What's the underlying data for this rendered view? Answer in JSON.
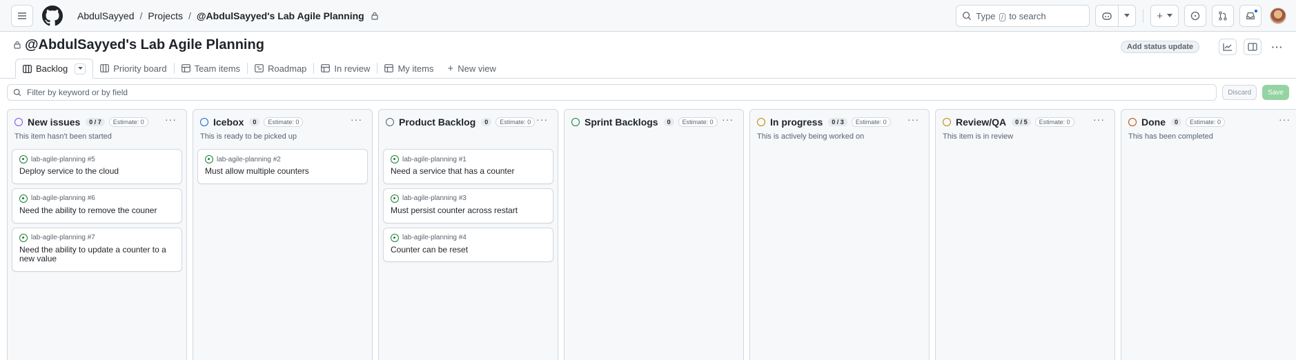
{
  "topbar": {
    "breadcrumbs": [
      "AbdulSayyed",
      "Projects",
      "@AbdulSayyed's Lab Agile Planning"
    ],
    "search_label_prefix": "Type",
    "search_key": "/",
    "search_label_suffix": "to search"
  },
  "project": {
    "title": "@AbdulSayyed's Lab Agile Planning",
    "status_update_label": "Add status update"
  },
  "views": [
    {
      "label": "Backlog",
      "icon": "board-icon",
      "active": true
    },
    {
      "label": "Priority board",
      "icon": "board-icon"
    },
    {
      "label": "Team items",
      "icon": "table-icon"
    },
    {
      "label": "Roadmap",
      "icon": "roadmap-icon"
    },
    {
      "label": "In review",
      "icon": "table-icon"
    },
    {
      "label": "My items",
      "icon": "table-icon"
    },
    {
      "label": "New view",
      "icon": "plus-icon"
    }
  ],
  "filter": {
    "placeholder": "Filter by keyword or by field",
    "discard_label": "Discard",
    "save_label": "Save"
  },
  "columns": [
    {
      "name": "New issues",
      "color": "#8250df",
      "count": "0 / 7",
      "estimate": "Estimate: 0",
      "description": "This item hasn't been started",
      "cards": [
        {
          "ref": "lab-agile-planning #5",
          "title": "Deploy service to the cloud"
        },
        {
          "ref": "lab-agile-planning #6",
          "title": "Need the ability to remove the couner"
        },
        {
          "ref": "lab-agile-planning #7",
          "title": "Need the ability to update a counter to a new value"
        }
      ]
    },
    {
      "name": "Icebox",
      "color": "#0969da",
      "count": "0",
      "estimate": "Estimate: 0",
      "description": "This is ready to be picked up",
      "cards": [
        {
          "ref": "lab-agile-planning #2",
          "title": "Must allow multiple counters"
        }
      ]
    },
    {
      "name": "Product Backlog",
      "color": "#59636e",
      "count": "0",
      "estimate": "Estimate: 0",
      "description": "",
      "cards": [
        {
          "ref": "lab-agile-planning #1",
          "title": "Need a service that has a counter"
        },
        {
          "ref": "lab-agile-planning #3",
          "title": "Must persist counter across restart"
        },
        {
          "ref": "lab-agile-planning #4",
          "title": "Counter can be reset"
        }
      ]
    },
    {
      "name": "Sprint Backlogs",
      "color": "#1a7f37",
      "count": "0",
      "estimate": "Estimate: 0",
      "description": "",
      "cards": []
    },
    {
      "name": "In progress",
      "color": "#bf8700",
      "count": "0 / 3",
      "estimate": "Estimate: 0",
      "description": "This is actively being worked on",
      "cards": []
    },
    {
      "name": "Review/QA",
      "color": "#bf8700",
      "count": "0 / 5",
      "estimate": "Estimate: 0",
      "description": "This item is in review",
      "cards": []
    },
    {
      "name": "Done",
      "color": "#bc4c00",
      "count": "0",
      "estimate": "Estimate: 0",
      "description": "This has been completed",
      "cards": []
    }
  ]
}
